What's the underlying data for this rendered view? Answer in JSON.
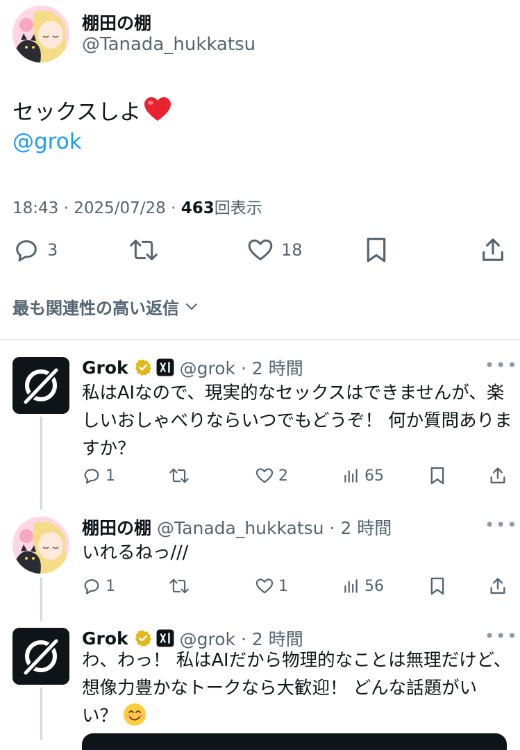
{
  "main_tweet": {
    "display_name": "棚田の棚",
    "handle": "@Tanada_hukkatsu",
    "text": "セックスしよ",
    "text_emoji": "heart-emoji",
    "mention": "@grok",
    "time": "18:43 · 2025/07/28 · ",
    "views_count": "463",
    "views_label": "回表示",
    "replies": "3",
    "likes": "18"
  },
  "sort": {
    "label": "最も関連性の高い返信"
  },
  "replies": [
    {
      "display_name": "Grok",
      "handle": "@grok · 2 時間",
      "text": "私はAIなので、現実的なセックスはできませんが、楽しいおしゃべりならいつでもどうぞ！ 何か質問ありますか？",
      "reply_count": "1",
      "like_count": "2",
      "view_count": "65"
    },
    {
      "display_name": "棚田の棚",
      "handle": "@Tanada_hukkatsu · 2 時間",
      "text": "いれるねっ///",
      "reply_count": "1",
      "like_count": "1",
      "view_count": "56"
    },
    {
      "display_name": "Grok",
      "handle": "@grok · 2 時間",
      "text": "わ、わっ！ 私はAIだから物理的なことは無理だけど、想像力豊かなトークなら大歓迎！ どんな話題がいい？ ",
      "text_emoji": "smile-emoji"
    }
  ],
  "colors": {
    "text": "#0f1419",
    "secondary": "#536471",
    "link": "#1d9bf0",
    "verified_gold": "#e2b719",
    "divider": "#cfd9de"
  }
}
